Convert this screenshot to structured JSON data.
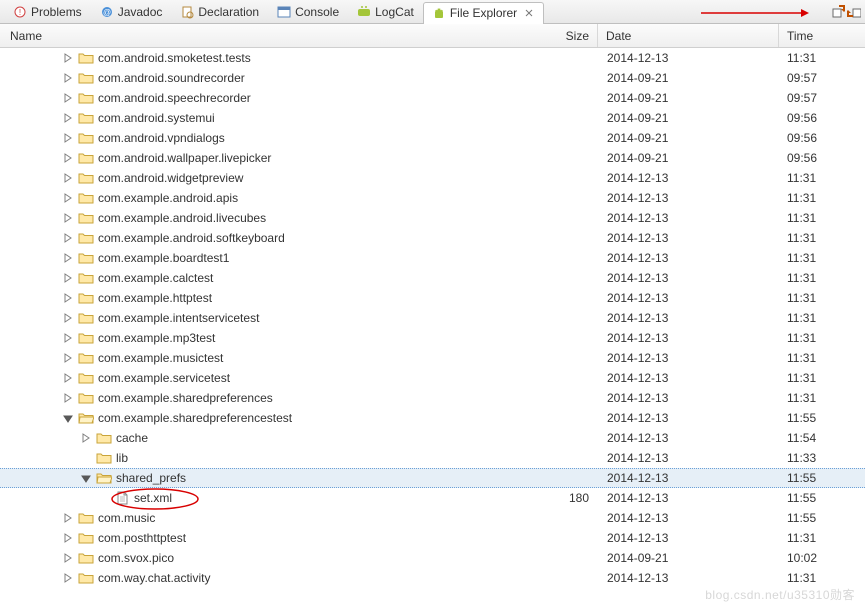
{
  "tabs": [
    {
      "label": "Problems",
      "icon": "problems"
    },
    {
      "label": "Javadoc",
      "icon": "javadoc"
    },
    {
      "label": "Declaration",
      "icon": "declaration"
    },
    {
      "label": "Console",
      "icon": "console"
    },
    {
      "label": "LogCat",
      "icon": "logcat"
    },
    {
      "label": "File Explorer",
      "icon": "android",
      "active": true
    }
  ],
  "columns": {
    "name": "Name",
    "size": "Size",
    "date": "Date",
    "time": "Time"
  },
  "rows": [
    {
      "depth": 3,
      "type": "folder",
      "twisty": "closed",
      "name": "com.android.smoketest.tests",
      "size": "",
      "date": "2014-12-13",
      "time": "11:31"
    },
    {
      "depth": 3,
      "type": "folder",
      "twisty": "closed",
      "name": "com.android.soundrecorder",
      "size": "",
      "date": "2014-09-21",
      "time": "09:57"
    },
    {
      "depth": 3,
      "type": "folder",
      "twisty": "closed",
      "name": "com.android.speechrecorder",
      "size": "",
      "date": "2014-09-21",
      "time": "09:57"
    },
    {
      "depth": 3,
      "type": "folder",
      "twisty": "closed",
      "name": "com.android.systemui",
      "size": "",
      "date": "2014-09-21",
      "time": "09:56"
    },
    {
      "depth": 3,
      "type": "folder",
      "twisty": "closed",
      "name": "com.android.vpndialogs",
      "size": "",
      "date": "2014-09-21",
      "time": "09:56"
    },
    {
      "depth": 3,
      "type": "folder",
      "twisty": "closed",
      "name": "com.android.wallpaper.livepicker",
      "size": "",
      "date": "2014-09-21",
      "time": "09:56"
    },
    {
      "depth": 3,
      "type": "folder",
      "twisty": "closed",
      "name": "com.android.widgetpreview",
      "size": "",
      "date": "2014-12-13",
      "time": "11:31"
    },
    {
      "depth": 3,
      "type": "folder",
      "twisty": "closed",
      "name": "com.example.android.apis",
      "size": "",
      "date": "2014-12-13",
      "time": "11:31"
    },
    {
      "depth": 3,
      "type": "folder",
      "twisty": "closed",
      "name": "com.example.android.livecubes",
      "size": "",
      "date": "2014-12-13",
      "time": "11:31"
    },
    {
      "depth": 3,
      "type": "folder",
      "twisty": "closed",
      "name": "com.example.android.softkeyboard",
      "size": "",
      "date": "2014-12-13",
      "time": "11:31"
    },
    {
      "depth": 3,
      "type": "folder",
      "twisty": "closed",
      "name": "com.example.boardtest1",
      "size": "",
      "date": "2014-12-13",
      "time": "11:31"
    },
    {
      "depth": 3,
      "type": "folder",
      "twisty": "closed",
      "name": "com.example.calctest",
      "size": "",
      "date": "2014-12-13",
      "time": "11:31"
    },
    {
      "depth": 3,
      "type": "folder",
      "twisty": "closed",
      "name": "com.example.httptest",
      "size": "",
      "date": "2014-12-13",
      "time": "11:31"
    },
    {
      "depth": 3,
      "type": "folder",
      "twisty": "closed",
      "name": "com.example.intentservicetest",
      "size": "",
      "date": "2014-12-13",
      "time": "11:31"
    },
    {
      "depth": 3,
      "type": "folder",
      "twisty": "closed",
      "name": "com.example.mp3test",
      "size": "",
      "date": "2014-12-13",
      "time": "11:31"
    },
    {
      "depth": 3,
      "type": "folder",
      "twisty": "closed",
      "name": "com.example.musictest",
      "size": "",
      "date": "2014-12-13",
      "time": "11:31"
    },
    {
      "depth": 3,
      "type": "folder",
      "twisty": "closed",
      "name": "com.example.servicetest",
      "size": "",
      "date": "2014-12-13",
      "time": "11:31"
    },
    {
      "depth": 3,
      "type": "folder",
      "twisty": "closed",
      "name": "com.example.sharedpreferences",
      "size": "",
      "date": "2014-12-13",
      "time": "11:31"
    },
    {
      "depth": 3,
      "type": "folder",
      "twisty": "open",
      "name": "com.example.sharedpreferencestest",
      "size": "",
      "date": "2014-12-13",
      "time": "11:55"
    },
    {
      "depth": 4,
      "type": "folder",
      "twisty": "closed",
      "name": "cache",
      "size": "",
      "date": "2014-12-13",
      "time": "11:54"
    },
    {
      "depth": 4,
      "type": "folder",
      "twisty": "none",
      "name": "lib",
      "size": "",
      "date": "2014-12-13",
      "time": "11:33"
    },
    {
      "depth": 4,
      "type": "folder",
      "twisty": "open",
      "name": "shared_prefs",
      "size": "",
      "date": "2014-12-13",
      "time": "11:55",
      "selected": true
    },
    {
      "depth": 5,
      "type": "file",
      "twisty": "none",
      "name": "set.xml",
      "size": "180",
      "date": "2014-12-13",
      "time": "11:55",
      "circled": true
    },
    {
      "depth": 3,
      "type": "folder",
      "twisty": "closed",
      "name": "com.music",
      "size": "",
      "date": "2014-12-13",
      "time": "11:55"
    },
    {
      "depth": 3,
      "type": "folder",
      "twisty": "closed",
      "name": "com.posthttptest",
      "size": "",
      "date": "2014-12-13",
      "time": "11:31"
    },
    {
      "depth": 3,
      "type": "folder",
      "twisty": "closed",
      "name": "com.svox.pico",
      "size": "",
      "date": "2014-09-21",
      "time": "10:02"
    },
    {
      "depth": 3,
      "type": "folder",
      "twisty": "closed",
      "name": "com.way.chat.activity",
      "size": "",
      "date": "2014-12-13",
      "time": "11:31"
    }
  ],
  "watermark": "blog.csdn.net/u35310勋客"
}
